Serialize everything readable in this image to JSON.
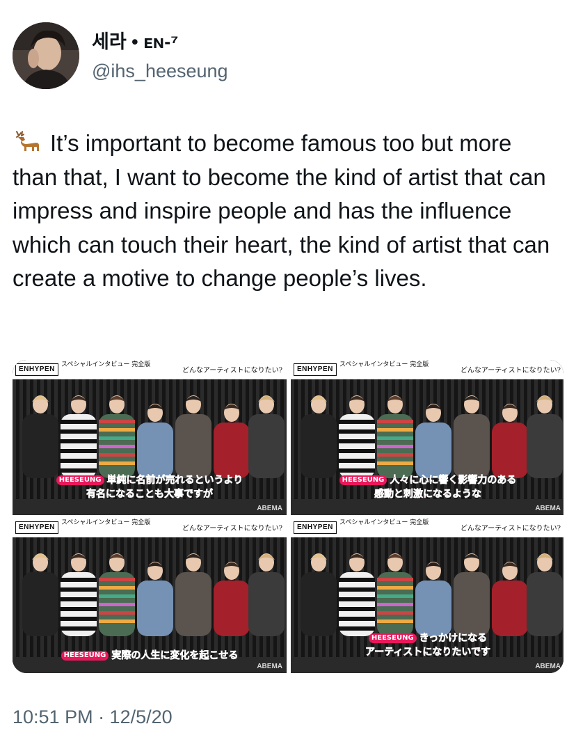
{
  "author": {
    "display_name": "세라 • ᴇɴ-⁷",
    "handle": "@ihs_heeseung",
    "avatar_icon": "user-avatar-photo"
  },
  "tweet": {
    "emoji": "deer-icon",
    "text": "It’s important to become famous too but more than that, I want to become the kind of artist that can impress and inspire people and has the influence which can touch their heart, the kind of artist that can create a motive to change people’s lives.",
    "timestamp": "10:51 PM · 12/5/20"
  },
  "media": [
    {
      "logo": "ENHYPEN",
      "special": "スペシャルインタビュー 完全版",
      "question": "どんなアーティストになりたい?",
      "speaker": "HEESEUNG",
      "line1": "単純に名前が売れるというより",
      "line2": "有名になることも大事ですが",
      "watermark": "ABEMA"
    },
    {
      "logo": "ENHYPEN",
      "special": "スペシャルインタビュー 完全版",
      "question": "どんなアーティストになりたい?",
      "speaker": "HEESEUNG",
      "line1": "人々に心に響く影響力のある",
      "line2": "感動と刺激になるような",
      "watermark": "ABEMA"
    },
    {
      "logo": "ENHYPEN",
      "special": "スペシャルインタビュー 完全版",
      "question": "どんなアーティストになりたい?",
      "speaker": "HEESEUNG",
      "line1": "実際の人生に変化を起こせる",
      "line2": "",
      "watermark": "ABEMA"
    },
    {
      "logo": "ENHYPEN",
      "special": "スペシャルインタビュー 完全版",
      "question": "どんなアーティストになりたい?",
      "speaker": "HEESEUNG",
      "line1": "きっかけになる",
      "line2": "アーティストになりたいです",
      "watermark": "ABEMA"
    }
  ]
}
